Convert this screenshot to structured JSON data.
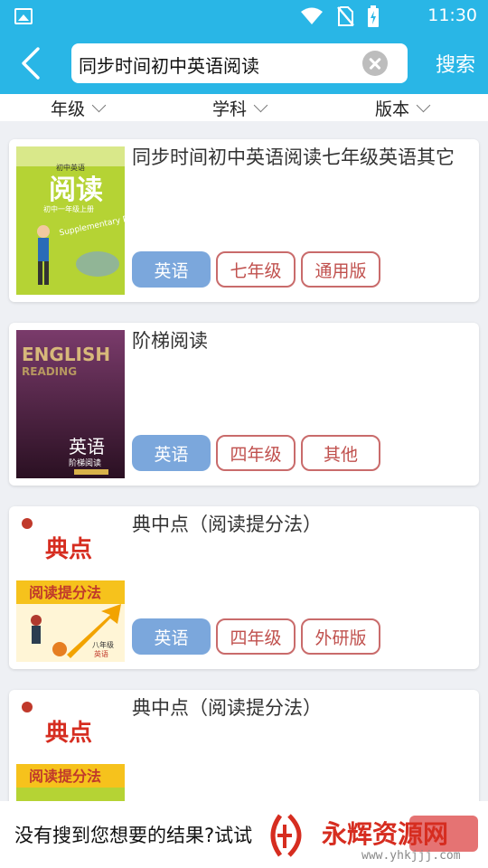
{
  "status": {
    "time": "11:30",
    "icons": [
      "gallery-icon",
      "wifi-icon",
      "no-sim-icon",
      "battery-charging-icon"
    ]
  },
  "header": {
    "search_value": "同步时间初中英语阅读",
    "search_button": "搜索"
  },
  "filters": [
    {
      "label": "年级"
    },
    {
      "label": "学科"
    },
    {
      "label": "版本"
    }
  ],
  "results": [
    {
      "title": "同步时间初中英语阅读七年级英语其它",
      "subject": "英语",
      "grade": "七年级",
      "edition": "通用版",
      "cover": {
        "header": "初中英语",
        "big": "阅读",
        "sub": "初中一年级上册",
        "en": "Supplementary Reading"
      }
    },
    {
      "title": "阶梯阅读",
      "subject": "英语",
      "grade": "四年级",
      "edition": "其他",
      "cover": {
        "en1": "ENGLISH",
        "en2": "READING",
        "cn": "英语",
        "cn2": "阶梯阅读"
      }
    },
    {
      "title": "典中点（阅读提分法）",
      "subject": "英语",
      "grade": "四年级",
      "edition": "外研版",
      "cover": {
        "brand": "典点",
        "band": "阅读提分法",
        "corner": "八年级",
        "corner2": "英语"
      }
    },
    {
      "title": "典中点（阅读提分法）",
      "cover": {
        "brand": "典点",
        "band": "阅读提分法"
      }
    }
  ],
  "bottom": {
    "message": "没有搜到您想要的结果?试试",
    "watermark_text": "永辉资源网",
    "watermark_url": "www.yhkjjj.com"
  },
  "colors": {
    "primary": "#29b6e6",
    "subject_tag": "#7ba7dc",
    "tag_border": "#c96b6b",
    "tag_text": "#c0504d"
  }
}
